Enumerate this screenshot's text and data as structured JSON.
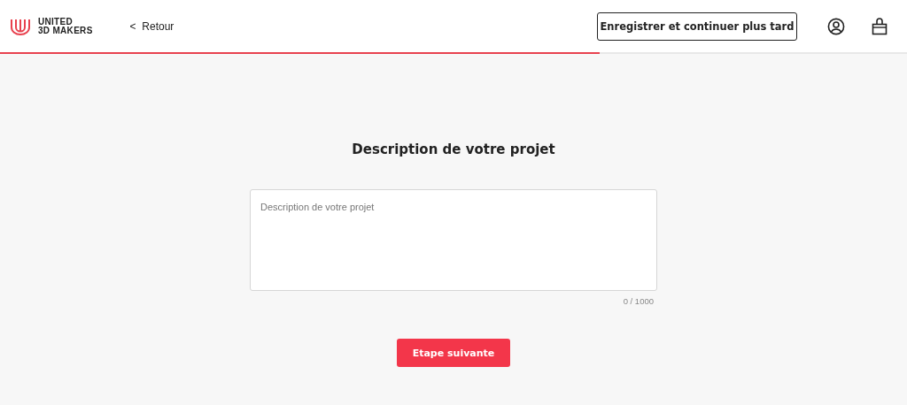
{
  "header": {
    "logo_line_1": "UNITED",
    "logo_line_2": "3D MAKERS",
    "back_link": "<  Retour",
    "save_button": "Enregistrer et continuer plus tard"
  },
  "progress": {
    "level": 0.661
  },
  "form": {
    "title": "Description de votre projet",
    "description": {
      "placeholder": "Description de votre projet",
      "counter": "0 / 1000"
    },
    "next_button": "Etape suivante"
  }
}
